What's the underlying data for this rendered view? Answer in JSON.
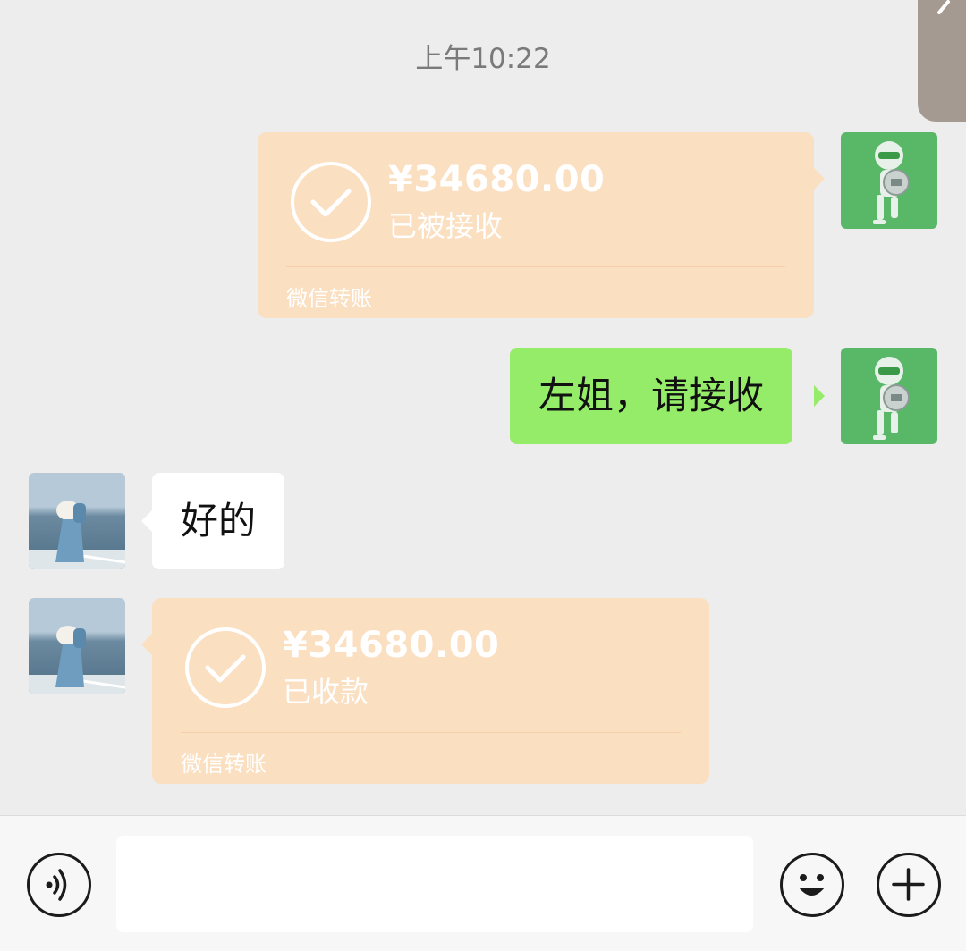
{
  "timestamp": "上午10:22",
  "messages": {
    "transfer_sent": {
      "amount": "¥34680.00",
      "status": "已被接收",
      "footer": "微信转账"
    },
    "text_sent": {
      "text": "左姐，请接收"
    },
    "text_received": {
      "text": "好的"
    },
    "transfer_received": {
      "amount": "¥34680.00",
      "status": "已收款",
      "footer": "微信转账"
    }
  },
  "input_bar": {
    "placeholder": ""
  },
  "colors": {
    "background": "#ededed",
    "transfer_bubble": "#fbdfc1",
    "sent_bubble": "#95ec69",
    "received_bubble": "#ffffff"
  },
  "icons": {
    "back": "chevron-left-icon",
    "voice": "voice-icon",
    "emoji": "emoji-icon",
    "more": "plus-icon",
    "check": "check-circle-icon"
  }
}
